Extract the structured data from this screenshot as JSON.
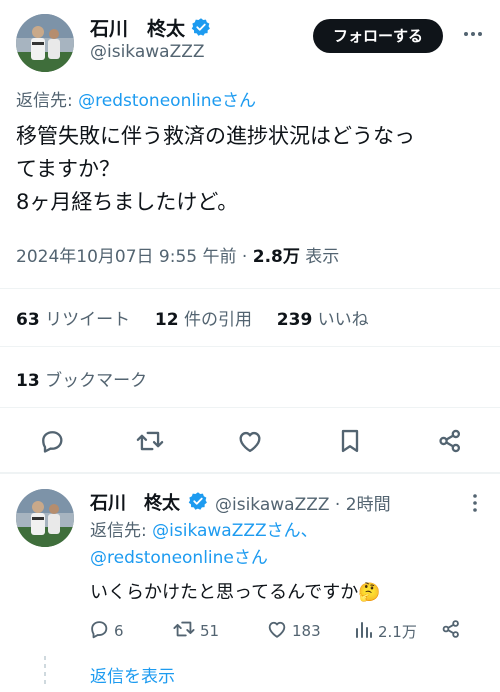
{
  "main_tweet": {
    "author_name": "石川　柊太",
    "author_handle": "@isikawaZZZ",
    "follow_label": "フォローする",
    "reply_to_prefix": "返信先: ",
    "reply_to_handle": "@redstoneonlineさん",
    "text_line1": "移管失敗に伴う救済の進捗状況はどうなっ",
    "text_line2": "てますか？",
    "text_line3": "8ヶ月経ちましたけど。",
    "timestamp": "2024年10月07日 9:55 午前",
    "separator": " · ",
    "views_count": "2.8万",
    "views_label": " 表示",
    "retweets_count": "63",
    "retweets_label": " リツイート",
    "quotes_count": "12",
    "quotes_label": " 件の引用",
    "likes_count": "239",
    "likes_label": " いいね",
    "bookmarks_count": "13",
    "bookmarks_label": " ブックマーク"
  },
  "reply_tweet": {
    "author_name": "石川　柊太",
    "author_handle": "@isikawaZZZ",
    "time_sep": " · ",
    "time_ago": "2時間",
    "reply_to_prefix": "返信先: ",
    "reply_to_handle1": "@isikawaZZZさん、",
    "reply_to_handle2": "@redstoneonlineさん",
    "text": "いくらかけたと思ってるんですか🤔",
    "replies": "6",
    "retweets": "51",
    "likes": "183",
    "views": "2.1万",
    "show_replies_label": "返信を表示"
  },
  "colors": {
    "accent": "#1d9bf0",
    "text": "#0f1419",
    "muted": "#536471",
    "divider": "#eff3f4"
  },
  "icons": [
    "verified-badge-icon",
    "more-icon",
    "reply-icon",
    "retweet-icon",
    "like-icon",
    "bookmark-icon",
    "share-icon",
    "views-icon"
  ]
}
